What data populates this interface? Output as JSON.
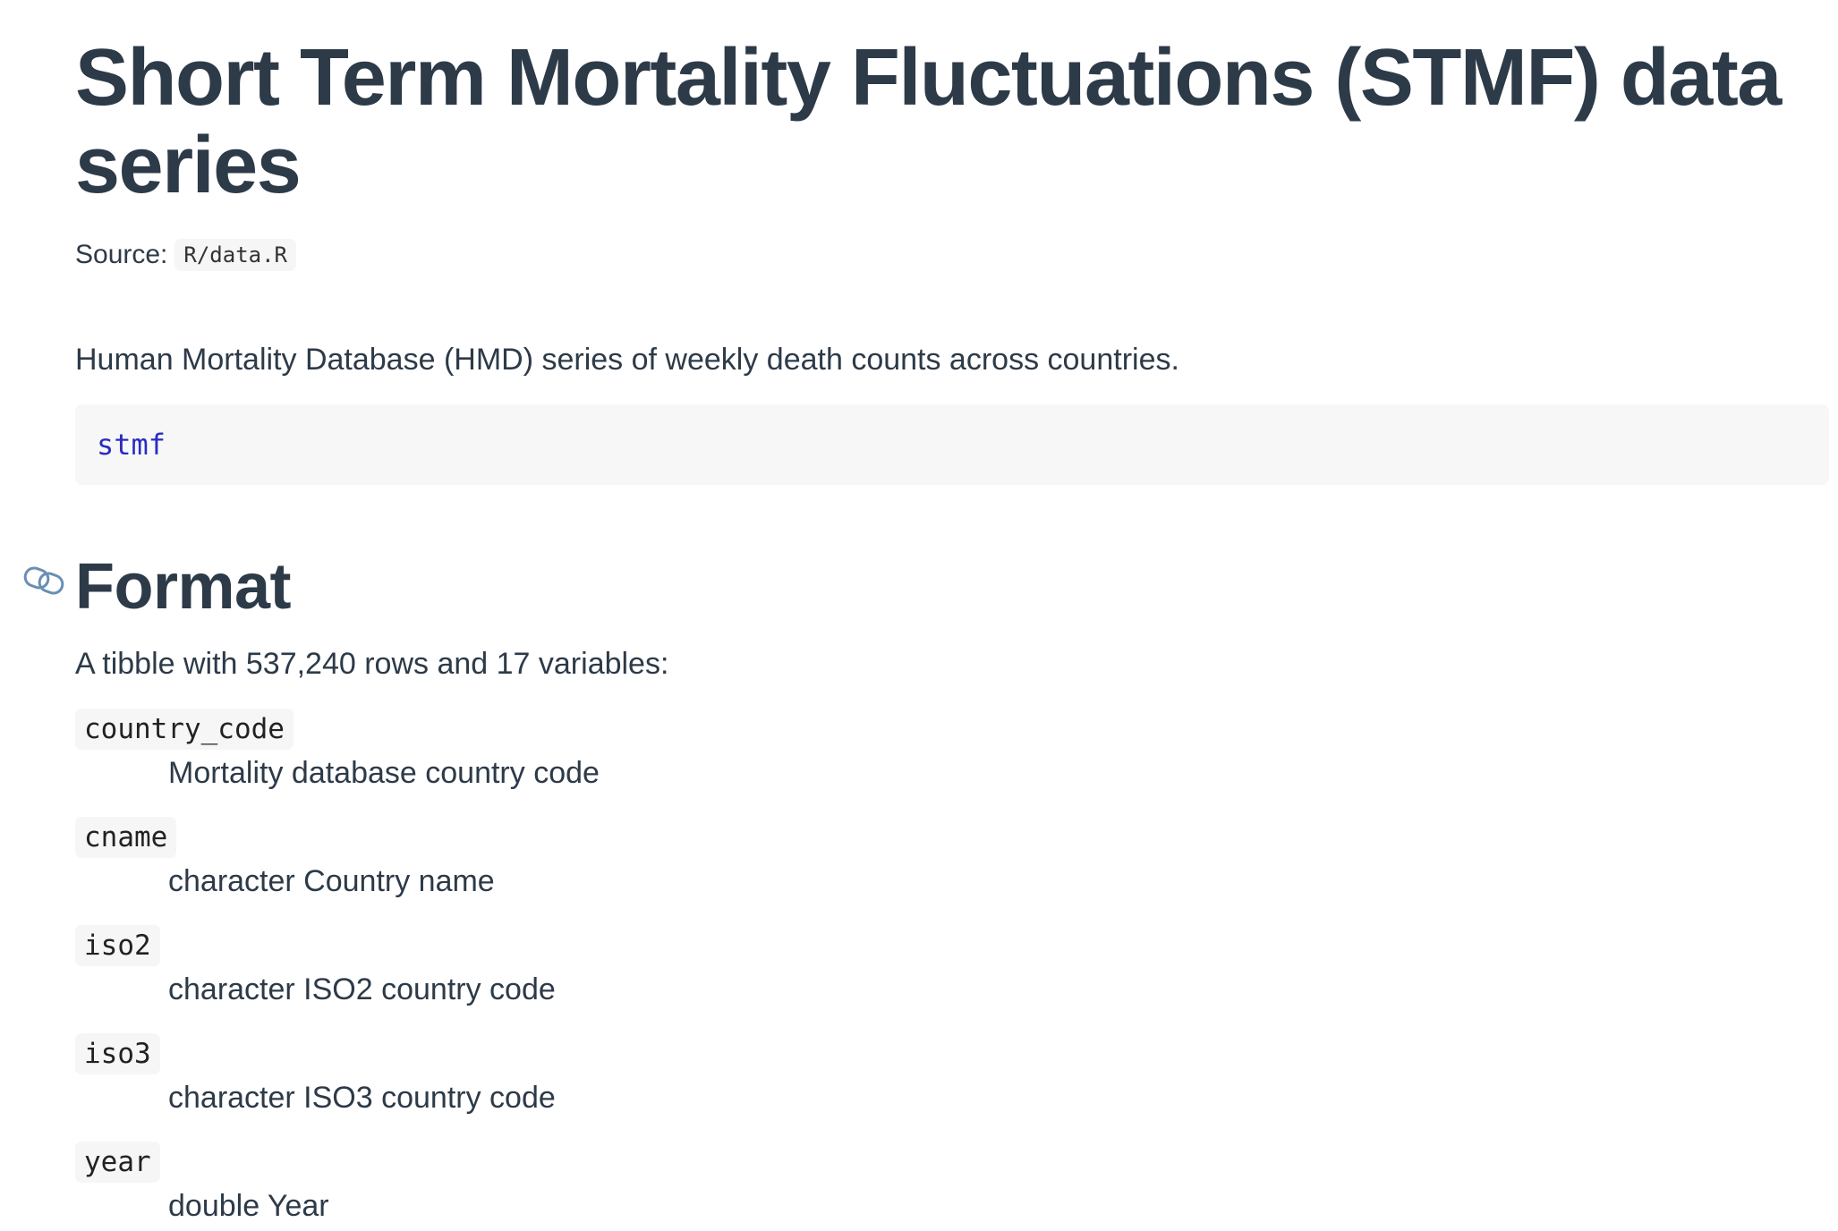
{
  "title": "Short Term Mortality Fluctuations (STMF) data series",
  "source": {
    "label": "Source:",
    "file": "R/data.R"
  },
  "description": "Human Mortality Database (HMD) series of weekly death counts across countries.",
  "usage": "stmf",
  "format": {
    "heading": "Format",
    "anchor_icon": "link-icon",
    "intro": "A tibble with 537,240 rows and 17 variables:",
    "variables": [
      {
        "name": "country_code",
        "desc": "Mortality database country code"
      },
      {
        "name": "cname",
        "desc": "character Country name"
      },
      {
        "name": "iso2",
        "desc": "character ISO2 country code"
      },
      {
        "name": "iso3",
        "desc": "character ISO3 country code"
      },
      {
        "name": "year",
        "desc": "double Year"
      }
    ]
  }
}
